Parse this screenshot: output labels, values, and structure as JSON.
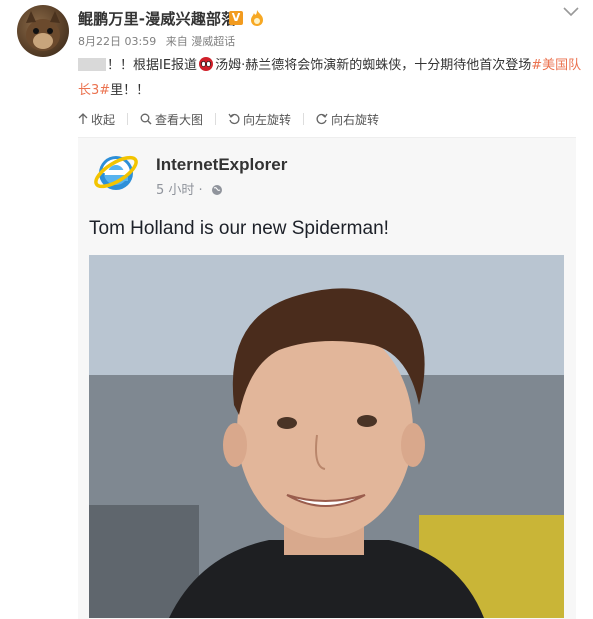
{
  "post": {
    "author": "鲲鹏万里-漫威兴趣部落",
    "verified_badge": "V",
    "date": "8月22日 03:59",
    "source": "来自 漫威超话",
    "text_before_icon": "！！根据IE报道",
    "text_after_icon": "汤姆·赫兰德将会饰演新的蜘蛛侠，十分期待他首次登场",
    "hashtag": "#美国队长3#",
    "text_end": "里！！"
  },
  "toolbar": {
    "collapse": "收起",
    "view_large": "查看大图",
    "rotate_left": "向左旋转",
    "rotate_right": "向右旋转"
  },
  "embed": {
    "page_name": "InternetExplorer",
    "time": "5 小时 · ",
    "text": "Tom Holland is our new Spiderman!"
  },
  "colors": {
    "hashtag": "#eb7350",
    "meta": "#808080",
    "badge": "#f29b1f"
  },
  "icons": [
    "chevron-down-icon",
    "spider-icon",
    "collapse-icon",
    "zoom-icon",
    "rotate-left-icon",
    "rotate-right-icon",
    "ie-logo",
    "globe-icon"
  ]
}
